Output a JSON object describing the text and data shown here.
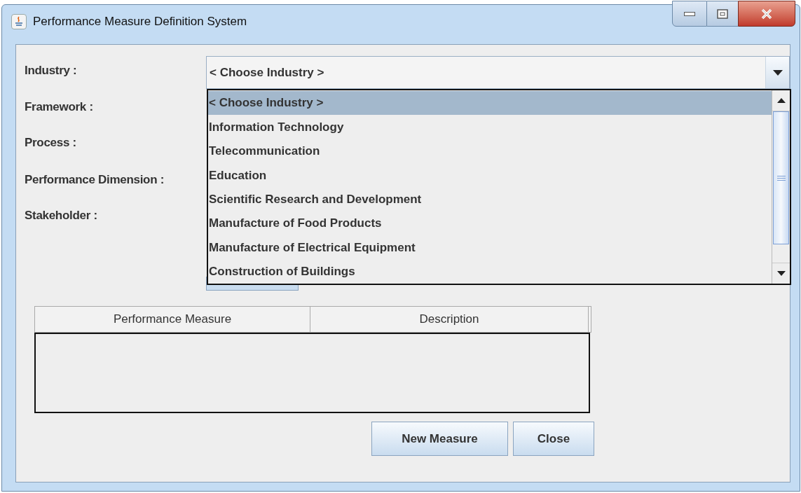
{
  "window": {
    "title": "Performance Measure Definition System"
  },
  "form": {
    "labels": [
      "Industry :",
      "Framework :",
      "Process :",
      "Performance Dimension :",
      "Stakeholder :"
    ],
    "industry": {
      "value": "< Choose Industry >",
      "expanded": true
    }
  },
  "dropdown": {
    "options": [
      {
        "label": "< Choose Industry >",
        "selected": true
      },
      {
        "label": "Information Technology",
        "selected": false
      },
      {
        "label": "Telecommunication",
        "selected": false
      },
      {
        "label": "Education",
        "selected": false
      },
      {
        "label": "Scientific Research and Development",
        "selected": false
      },
      {
        "label": "Manufacture of Food Products",
        "selected": false
      },
      {
        "label": "Manufacture of Electrical Equipment",
        "selected": false
      },
      {
        "label": "Construction of Buildings",
        "selected": false
      }
    ]
  },
  "table": {
    "columns": [
      "Performance Measure",
      "Description"
    ]
  },
  "buttons": [
    "New Measure",
    "Close"
  ]
}
